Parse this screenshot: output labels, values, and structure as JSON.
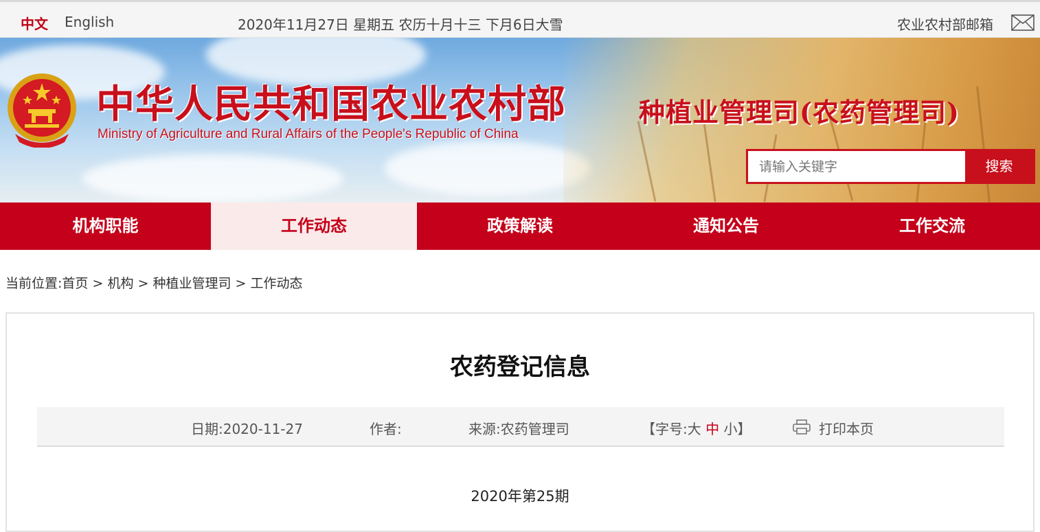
{
  "topbar": {
    "lang_zh": "中文",
    "lang_en": "English",
    "date": "2020年11月27日 星期五 农历十月十三 下月6日大雪",
    "mail_label": "农业农村部邮箱"
  },
  "banner": {
    "ministry_cn": "中华人民共和国农业农村部",
    "ministry_en": "Ministry of Agriculture and Rural Affairs of the People's Republic of China",
    "dept_name": "种植业管理司(农药管理司)",
    "search_placeholder": "请输入关键字",
    "search_button": "搜索"
  },
  "nav": {
    "items": [
      {
        "label": "机构职能"
      },
      {
        "label": "工作动态"
      },
      {
        "label": "政策解读"
      },
      {
        "label": "通知公告"
      },
      {
        "label": "工作交流"
      }
    ],
    "active_index": 1
  },
  "breadcrumb": {
    "prefix": "当前位置:",
    "items": [
      "首页",
      "机构",
      "种植业管理司",
      "工作动态"
    ],
    "separator": ">"
  },
  "article": {
    "title": "农药登记信息",
    "date": "日期:2020-11-27",
    "author": "作者:",
    "source": "来源:农药管理司",
    "fontsize_prefix": "【字号:",
    "fontsize_big": "大",
    "fontsize_mid": "中",
    "fontsize_small": "小",
    "fontsize_suffix": "】",
    "print_label": "打印本页",
    "issue": "2020年第25期"
  },
  "colors": {
    "primary_red": "#c4001a",
    "nav_active_bg": "#fbeaea",
    "topbar_bg": "#f5f5f5"
  }
}
